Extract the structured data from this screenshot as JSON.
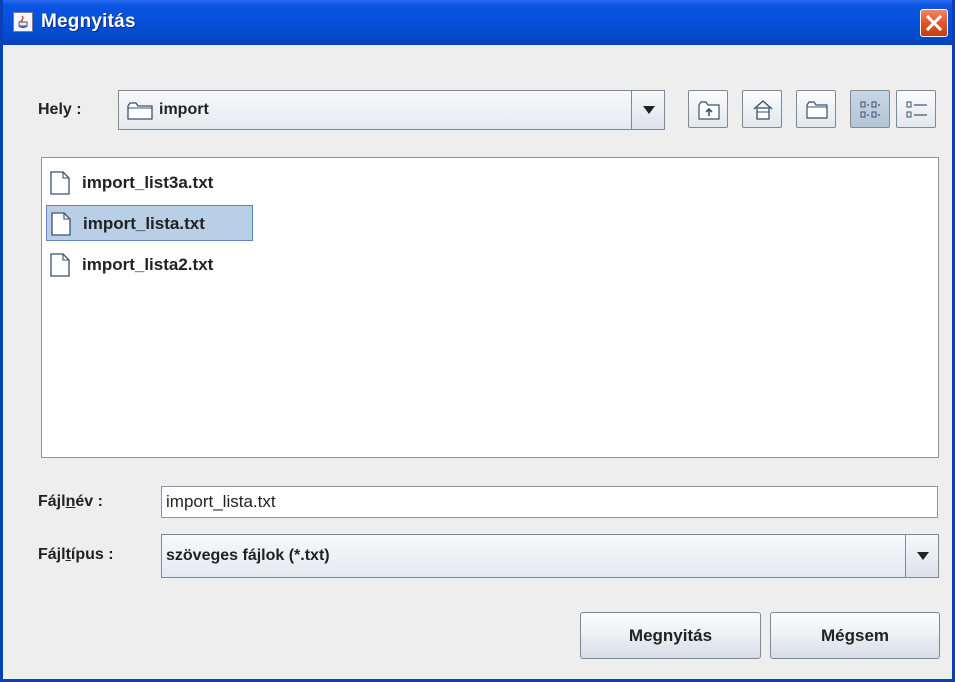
{
  "window": {
    "title": "Megnyitás",
    "close_label": "✕",
    "title_bar_color": "#0650d8",
    "close_color": "#e0552c"
  },
  "location": {
    "label": "Hely :",
    "value": "import"
  },
  "toolbar": {
    "buttons": [
      {
        "name": "up-one-level",
        "icon": "folder-up-icon",
        "pressed": false
      },
      {
        "name": "home",
        "icon": "home-icon",
        "pressed": false
      },
      {
        "name": "new-folder",
        "icon": "new-folder-icon",
        "pressed": false
      },
      {
        "name": "list-view",
        "icon": "list-view-icon",
        "pressed": true
      },
      {
        "name": "details-view",
        "icon": "details-view-icon",
        "pressed": false
      }
    ]
  },
  "files": [
    {
      "name": "import_list3a.txt",
      "icon": "file-icon",
      "selected": false
    },
    {
      "name": "import_lista.txt",
      "icon": "file-icon",
      "selected": true
    },
    {
      "name": "import_lista2.txt",
      "icon": "file-icon",
      "selected": false
    }
  ],
  "filename": {
    "label_pre": "Fájl",
    "label_mnemonic": "n",
    "label_post": "év :",
    "value": "import_lista.txt"
  },
  "filetype": {
    "label_pre": "Fájl",
    "label_mnemonic": "t",
    "label_post": "ípus :",
    "value": "szöveges fájlok (*.txt)"
  },
  "buttons": {
    "open": "Megnyitás",
    "cancel": "Mégsem"
  },
  "colors": {
    "selection": "#b8cfe5",
    "dialog_bg": "#eeeeee"
  }
}
